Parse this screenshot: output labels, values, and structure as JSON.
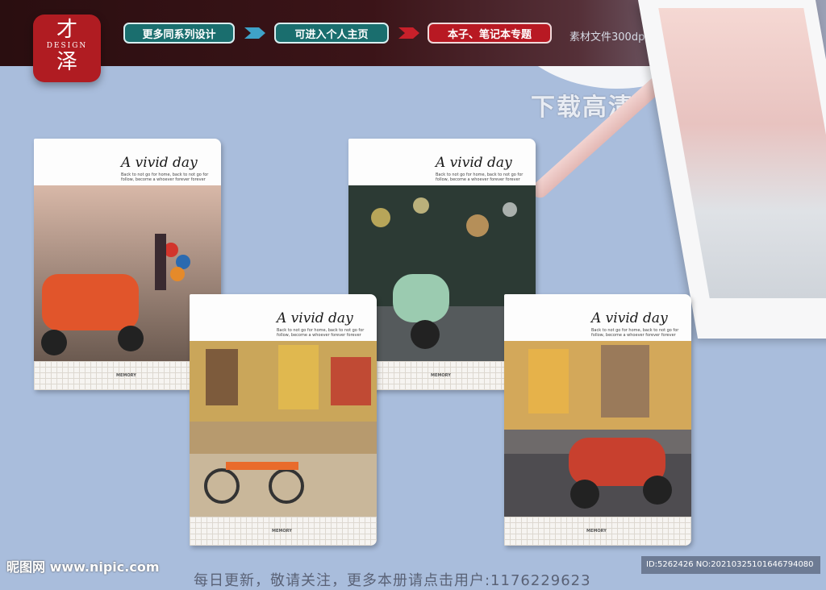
{
  "header": {
    "logo": {
      "char_top": "才",
      "mid": "DESIGN",
      "char_bottom": "泽"
    },
    "pills": [
      {
        "label": "更多同系列设计",
        "style": "teal"
      },
      {
        "label": "可进入个人主页",
        "style": "teal"
      },
      {
        "label": "本子、笔记本专题",
        "style": "red"
      }
    ],
    "resolution_text": "素材文件300dpi",
    "download_text": "下载高清"
  },
  "notebooks": [
    {
      "title": "A vivid day",
      "subtitle": "Back to not go for home, back to not go for follow, become a whoever forever forever",
      "footer_label": "MEMORY",
      "scene": "orange scooter with girl and balloons"
    },
    {
      "title": "A vivid day",
      "subtitle": "Back to not go for home, back to not go for follow, become a whoever forever forever",
      "footer_label": "MEMORY",
      "scene": "green scooter with bokeh lights"
    },
    {
      "title": "A vivid day",
      "subtitle": "Back to not go for home, back to not go for follow, become a whoever forever forever",
      "footer_label": "MEMORY",
      "scene": "row of bicycles on street"
    },
    {
      "title": "A vivid day",
      "subtitle": "Back to not go for home, back to not go for follow, become a whoever forever forever",
      "footer_label": "MEMORY",
      "scene": "red scooter on city street"
    }
  ],
  "footer": {
    "watermark": "昵图网 www.nipic.com",
    "id_text": "ID:5262426 NO:20210325101646794080",
    "bottom_text": "每日更新，敬请关注，更多本册请点击用户:1176229623"
  },
  "colors": {
    "logo_red": "#b01c22",
    "pill_teal": "#1a6e6e",
    "pill_red": "#b81923",
    "background": "#a9bddc"
  }
}
